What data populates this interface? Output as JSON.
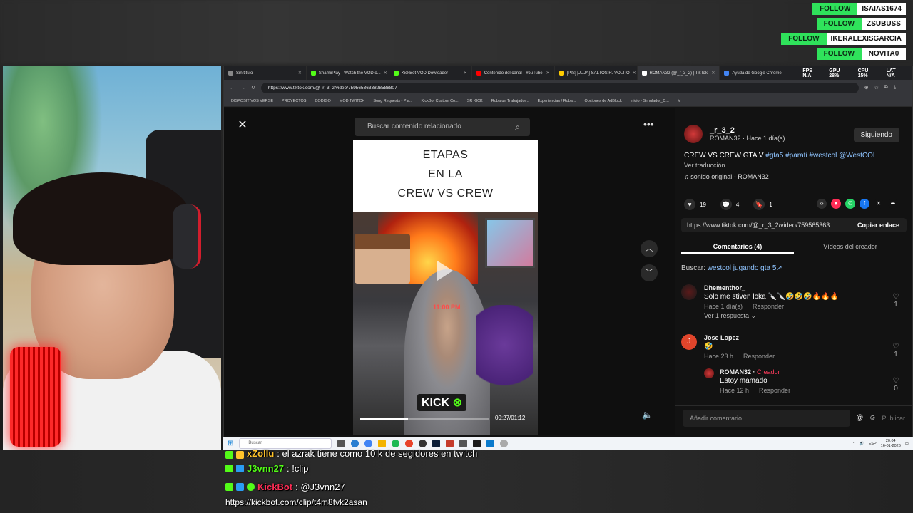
{
  "follow_alerts": [
    {
      "button": "FOLLOW",
      "name": "ISAIAS1674"
    },
    {
      "button": "FOLLOW",
      "name": "ZSUBUSS"
    },
    {
      "button": "FOLLOW",
      "name": "IKERALEXISGARCIA"
    },
    {
      "button": "FOLLOW",
      "name": "NOVITA0"
    }
  ],
  "browser": {
    "tabs": [
      {
        "title": "Sin título",
        "color": "#888888"
      },
      {
        "title": "ShamiiPlay - Watch the VOD o...",
        "color": "#53fc18"
      },
      {
        "title": "KickBot VOD Dowloader",
        "color": "#53fc18"
      },
      {
        "title": "Contenido del canal - YouTube",
        "color": "#ff0000"
      },
      {
        "title": "[PIS] [JUJA] SALTOS R. VOLTIO",
        "color": "#ffcc00"
      },
      {
        "title": "ROMAN32 (@_r_3_2) | TikTok",
        "color": "#ffffff"
      },
      {
        "title": "Ayuda de Google Chrome",
        "color": "#4285f4"
      }
    ],
    "perf": {
      "fps": "FPS N/A",
      "gpu": "GPU 28%",
      "cpu": "CPU 15%",
      "lat": "LAT N/A"
    },
    "url": "https://www.tiktok.com/@_r_3_2/video/7595653633828588807",
    "bookmarks": [
      "DISPOSITIVOS VERSE",
      "PROYECTOS",
      "CODIGO",
      "MOD TWITCH",
      "Song Requests - Pla...",
      "KickBot Custom Co...",
      "SR KICK",
      "Roba un Trabajador...",
      "Experiencias / Roba...",
      "Opciones de AdBlock",
      "Inicio - Simulador_D...",
      "M"
    ]
  },
  "viewer": {
    "search_placeholder": "Buscar contenido relacionado",
    "video_title_lines": [
      "ETAPAS",
      "EN LA",
      "CREW VS CREW"
    ],
    "overlay_time": "11:00 PM",
    "kick_logo": "KICK",
    "playback_time": "00:27/01:12",
    "progress_fraction": 0.37
  },
  "panel": {
    "author_handle": "_r_3_2",
    "author_sub": "ROMAN32 · Hace 1 día(s)",
    "follow_state": "Siguiendo",
    "caption_text": "CREW VS CREW GTA V ",
    "caption_tags": "#gta5 #parati #westcol @WestCOL",
    "translate": "Ver traducción",
    "sound": "♫  sonido original - ROMAN32",
    "likes": "19",
    "comments": "4",
    "saves": "1",
    "link": "https://www.tiktok.com/@_r_3_2/video/759565363...",
    "copy_label": "Copiar enlace",
    "tab_comments": "Comentarios (4)",
    "tab_videos": "Vídeos del creador",
    "search_label": "Buscar: ",
    "search_query": "westcol jugando gta 5",
    "comments_list": [
      {
        "name": "Dhementhor_",
        "text": "Solo me stiven loka 🔪🔪🤣🤣🤣🔥🔥🔥",
        "time": "Hace 1 día(s)",
        "reply": "Responder",
        "likes": "1",
        "extra": "Ver 1 respuesta ⌄"
      },
      {
        "name": "Jose Lopez",
        "text": "🤣",
        "time": "Hace 23 h",
        "reply": "Responder",
        "likes": "1"
      },
      {
        "name": "ROMAN32 · ",
        "creator": "Creador",
        "text": "Estoy mamado",
        "time": "Hace 12 h",
        "reply": "Responder",
        "likes": "0"
      }
    ],
    "add_comment": "Añadir comentario...",
    "publish": "Publicar"
  },
  "taskbar": {
    "search": "Buscar",
    "lang": "ESP",
    "time": "20:04",
    "date": "16-01-2026"
  },
  "chat": [
    {
      "nick": "xZollu",
      "text": ": el azrak tiene como 10 k de segidores en twitch",
      "color": "gold"
    },
    {
      "nick": "J3vnn27",
      "text": ": !clip",
      "color": "green"
    },
    {
      "nick": "KickBot",
      "text": ": @J3vnn27",
      "color": "red"
    }
  ],
  "clip_url": "https://kickbot.com/clip/t4m8tvk2asan"
}
